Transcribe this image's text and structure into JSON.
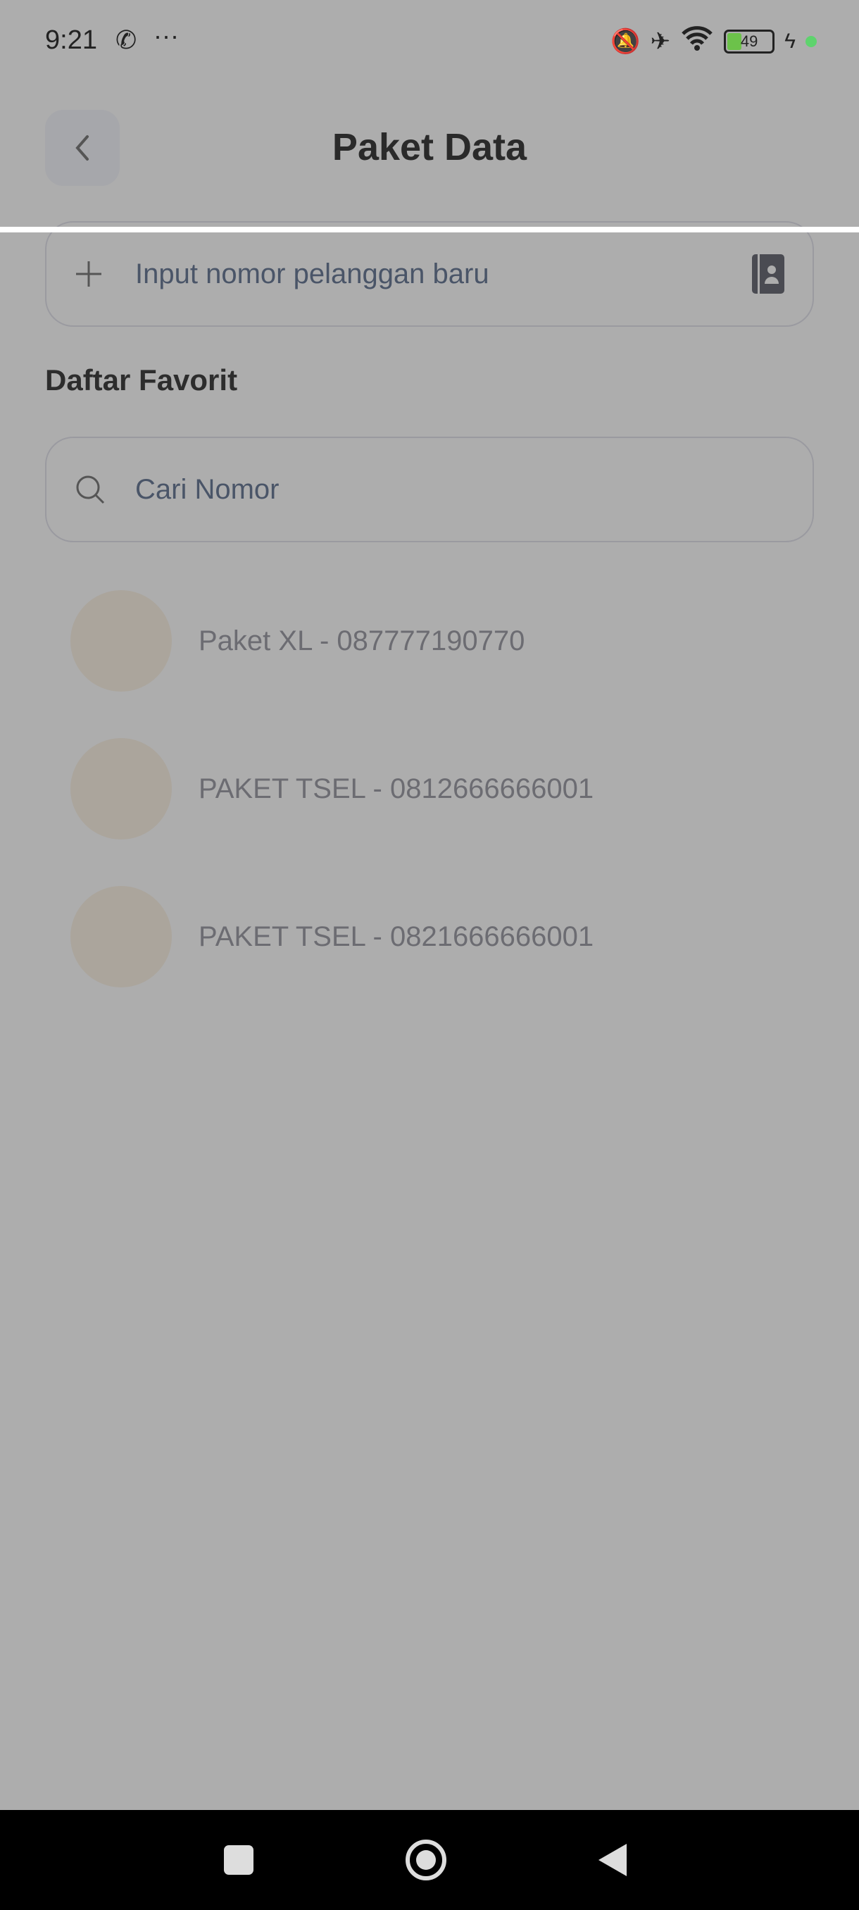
{
  "status_bar": {
    "time": "9:21",
    "battery": "49",
    "icons": [
      "whatsapp-icon",
      "more-icon",
      "mute-icon",
      "airplane-icon",
      "wifi-icon",
      "battery-icon",
      "charging-icon"
    ]
  },
  "header": {
    "title": "Paket Data"
  },
  "new_number": {
    "placeholder": "Input nomor pelanggan baru"
  },
  "favorites": {
    "heading": "Daftar Favorit",
    "search_placeholder": "Cari Nomor",
    "items": [
      {
        "label": "Paket XL - 087777190770"
      },
      {
        "label": "PAKET TSEL - 0812666666001"
      },
      {
        "label": "PAKET TSEL - 0821666666001"
      }
    ]
  },
  "colors": {
    "background": "#adadad",
    "avatar": "#aba59c"
  }
}
